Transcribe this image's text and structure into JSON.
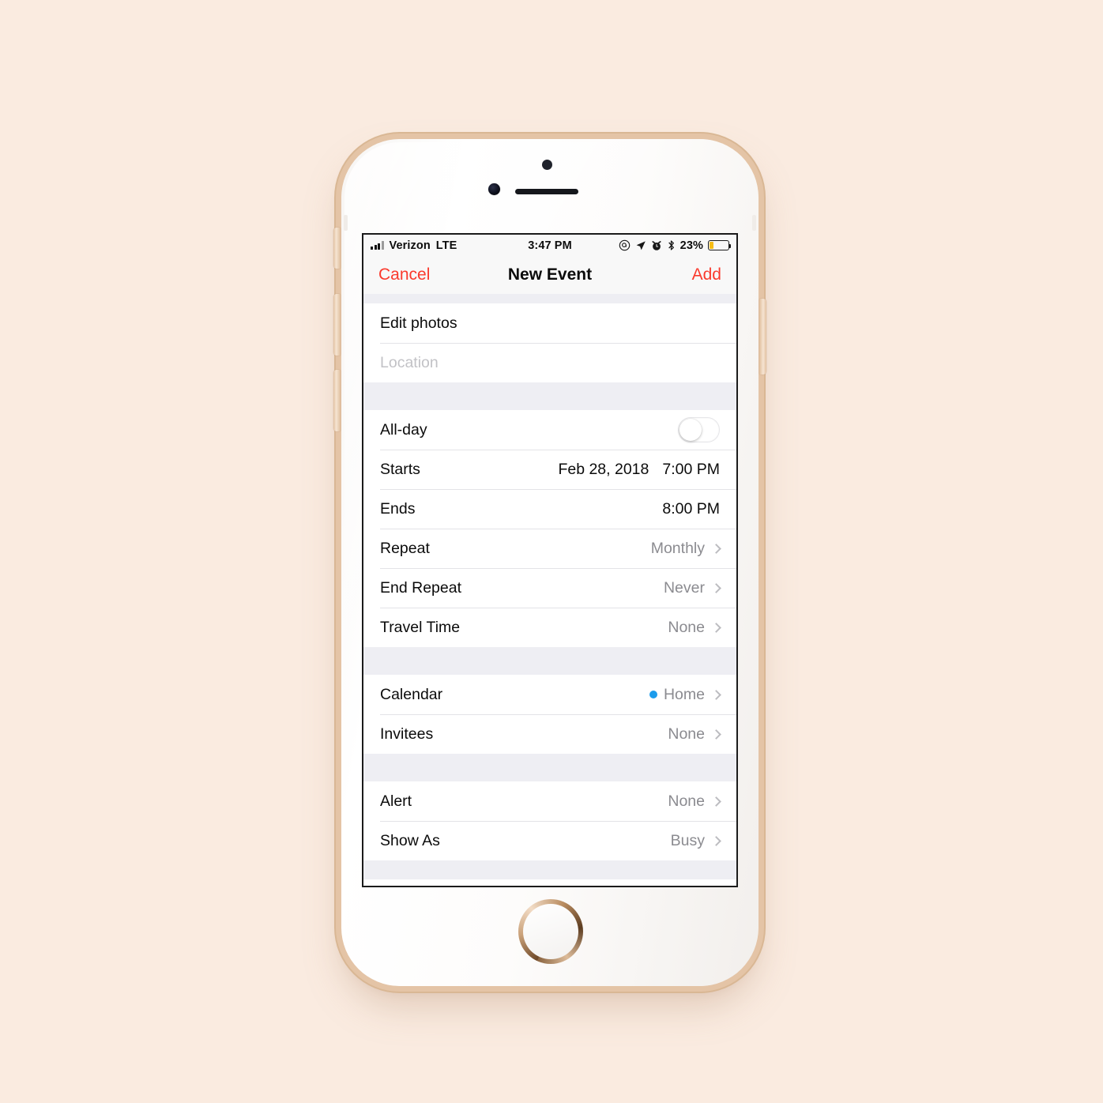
{
  "status_bar": {
    "carrier": "Verizon",
    "network": "LTE",
    "time": "3:47 PM",
    "battery_percent": "23%",
    "battery_level": 23,
    "battery_color": "#f6bd16",
    "icons": [
      "signal-bars-icon",
      "orientation-lock-icon",
      "location-arrow-icon",
      "alarm-clock-icon",
      "bluetooth-icon",
      "battery-icon"
    ]
  },
  "navbar": {
    "cancel_label": "Cancel",
    "title": "New Event",
    "add_label": "Add",
    "accent_color": "#fa3a2d"
  },
  "sections": {
    "details": {
      "title_value": "Edit photos",
      "location_placeholder": "Location"
    },
    "timing": {
      "allday_label": "All-day",
      "allday_on": false,
      "starts_label": "Starts",
      "starts_date": "Feb 28, 2018",
      "starts_time": "7:00 PM",
      "ends_label": "Ends",
      "ends_time": "8:00 PM",
      "repeat_label": "Repeat",
      "repeat_value": "Monthly",
      "end_repeat_label": "End Repeat",
      "end_repeat_value": "Never",
      "travel_time_label": "Travel Time",
      "travel_time_value": "None"
    },
    "calendar": {
      "calendar_label": "Calendar",
      "calendar_value": "Home",
      "calendar_dot_color": "#1c9cec",
      "invitees_label": "Invitees",
      "invitees_value": "None"
    },
    "options": {
      "alert_label": "Alert",
      "alert_value": "None",
      "show_as_label": "Show As",
      "show_as_value": "Busy"
    }
  },
  "device": {
    "body_color": "#ffffff",
    "bezel_color": "#e4c4a6",
    "background_color": "#faebe0"
  }
}
